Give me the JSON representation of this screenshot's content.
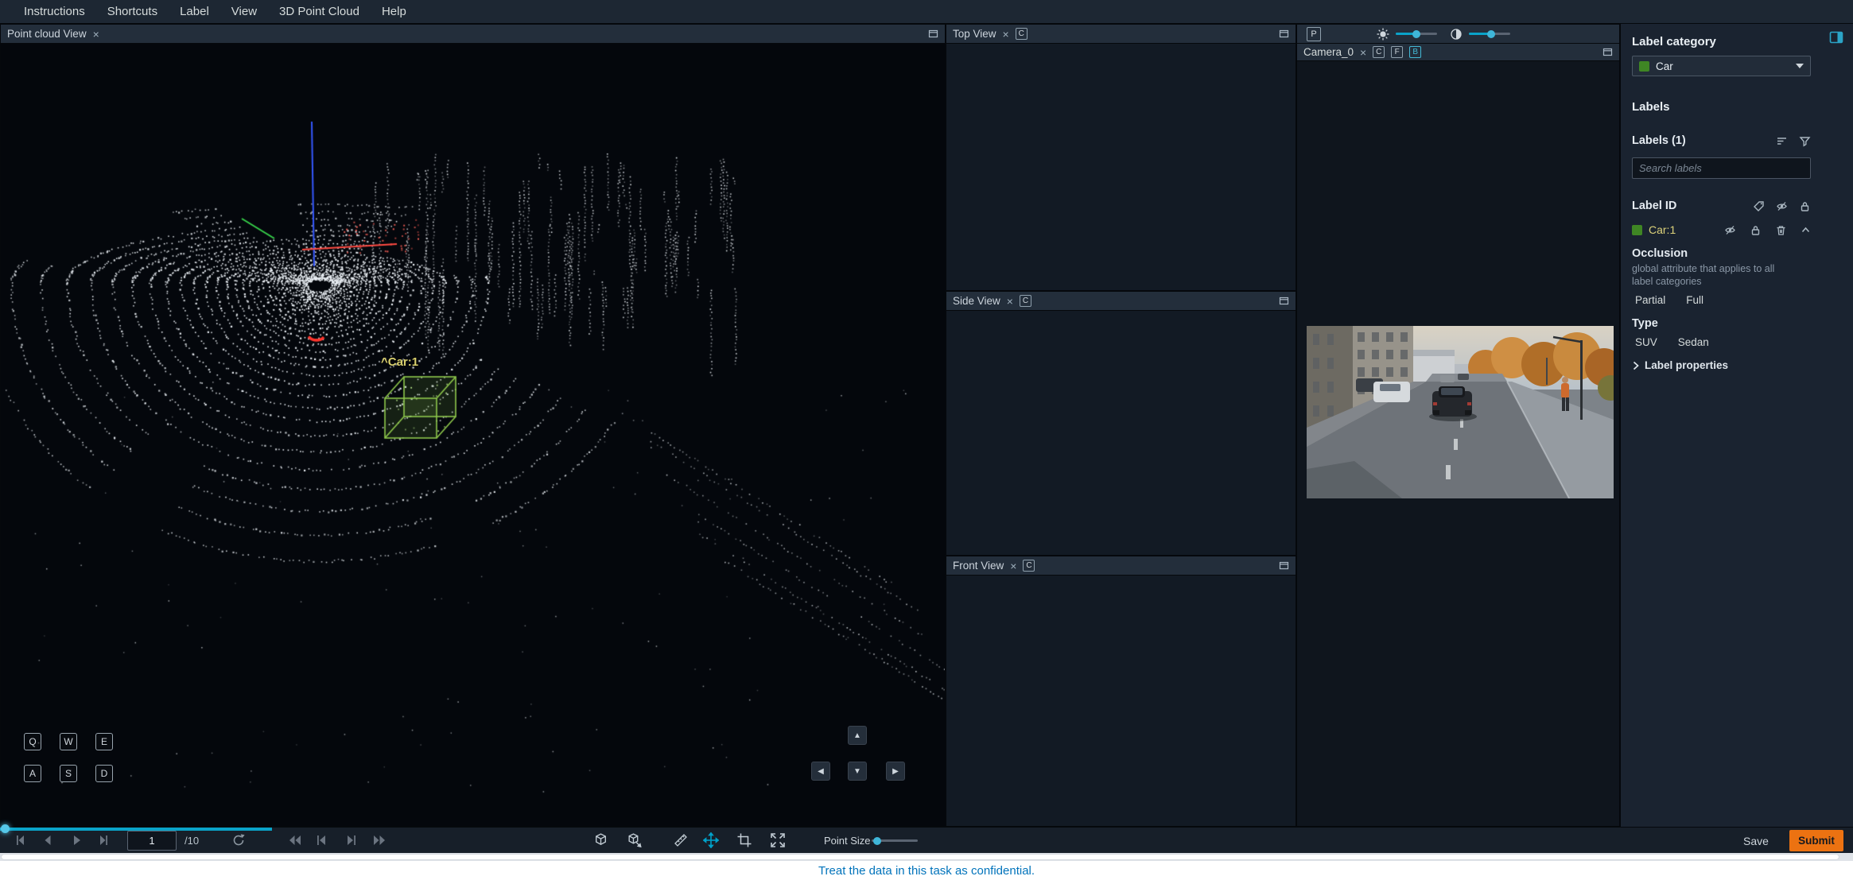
{
  "menubar": {
    "items": [
      "Instructions",
      "Shortcuts",
      "Label",
      "View",
      "3D Point Cloud",
      "Help"
    ]
  },
  "glyphs": {
    "close": "×",
    "up_arrow": "▲",
    "down_arrow": "▼",
    "left_arrow": "◀",
    "right_arrow": "▶"
  },
  "point_cloud": {
    "title": "Point cloud View",
    "box_label": "^Car:1",
    "keys": [
      "Q",
      "W",
      "E",
      "A",
      "S",
      "D"
    ]
  },
  "views": {
    "top": {
      "title": "Top View",
      "badge": "C"
    },
    "side": {
      "title": "Side View",
      "badge": "C"
    },
    "front": {
      "title": "Front View",
      "badge": "C"
    }
  },
  "camera": {
    "title": "Camera_0",
    "projection_button": "P",
    "badges": [
      "C",
      "F",
      "B"
    ]
  },
  "sidebar": {
    "label_category_heading": "Label category",
    "category_value": "Car",
    "labels_heading": "Labels",
    "labels_count": "Labels (1)",
    "search_placeholder": "Search labels",
    "label_id_heading": "Label ID",
    "label_name": "Car:1",
    "occlusion_heading": "Occlusion",
    "occlusion_description": "global attribute that applies to all label categories",
    "occlusion_options": [
      "Partial",
      "Full"
    ],
    "type_heading": "Type",
    "type_options": [
      "SUV",
      "Sedan"
    ],
    "label_properties_label": "Label properties"
  },
  "bottom_bar": {
    "frame_value": "1",
    "frame_total": "/10",
    "point_size_label": "Point Size",
    "save_label": "Save",
    "submit_label": "Submit"
  },
  "footer": {
    "confidential_notice": "Treat the data in this task as confidential."
  },
  "colors": {
    "accent_blue": "#00a1c9",
    "submit_orange": "#ec7211",
    "label_green": "#3f8624",
    "box_green": "#8ec84b",
    "box_label_yellow": "#d9d06d",
    "footer_link_blue": "#0073bb"
  }
}
